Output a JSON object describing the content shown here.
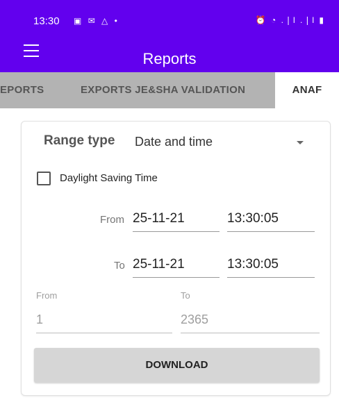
{
  "status_bar": {
    "time": "13:30",
    "notification_icons": "▣ ✉ △ •",
    "system_icons": "⏰ ◔ .❘l .❘l ▮"
  },
  "app_bar": {
    "title": "Reports",
    "menu_icon": "hamburger-menu-icon",
    "background": "#6200ee"
  },
  "tabs": [
    {
      "label": "EPORTS"
    },
    {
      "label": "EXPORTS JE&SHA VALIDATION"
    },
    {
      "label": "ANAF",
      "active": true
    }
  ],
  "form": {
    "range_type_label": "Range type",
    "range_type_value": "Date and time",
    "dst_label": "Daylight Saving Time",
    "dst_checked": false,
    "from_label": "From",
    "from_date": "25-11-21",
    "from_time": "13:30:05",
    "to_label": "To",
    "to_date": "25-11-21",
    "to_time": "13:30:05",
    "number_from_label": "From",
    "number_from_value": "1",
    "number_to_label": "To",
    "number_to_value": "2365",
    "download_label": "DOWNLOAD"
  }
}
